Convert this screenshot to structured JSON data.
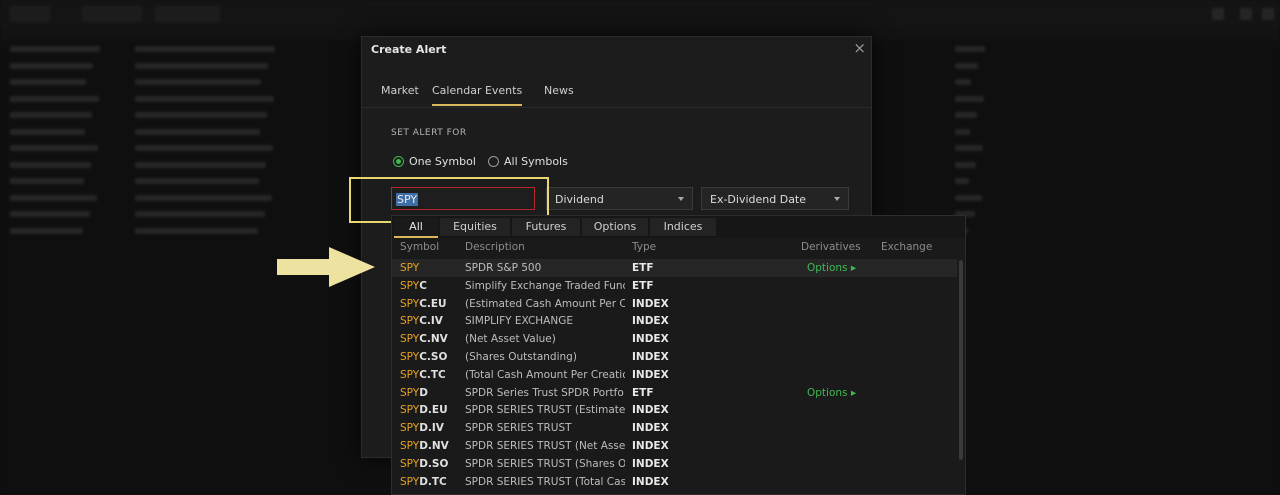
{
  "modal": {
    "title": "Create Alert",
    "close": "×",
    "tabs": [
      "Market",
      "Calendar Events",
      "News"
    ],
    "active_tab": "Calendar Events",
    "section_label": "SET ALERT FOR",
    "radio_one": "One Symbol",
    "radio_all": "All Symbols",
    "symbol_value": "SPY",
    "event_type": "Dividend",
    "date_field": "Ex-Dividend Date"
  },
  "results": {
    "tabs": [
      "All",
      "Equities",
      "Futures",
      "Options",
      "Indices"
    ],
    "columns": [
      "Symbol",
      "Description",
      "Type",
      "Derivatives",
      "Exchange"
    ],
    "rows": [
      {
        "match": "SPY",
        "rest": "",
        "desc": "SPDR S&P 500",
        "type": "ETF",
        "deriv": "Options ▸"
      },
      {
        "match": "SPY",
        "rest": "C",
        "desc": "Simplify Exchange Traded Fund",
        "type": "ETF",
        "deriv": ""
      },
      {
        "match": "SPY",
        "rest": "C.EU",
        "desc": "(Estimated Cash Amount Per C",
        "type": "INDEX",
        "deriv": ""
      },
      {
        "match": "SPY",
        "rest": "C.IV",
        "desc": "SIMPLIFY EXCHANGE",
        "type": "INDEX",
        "deriv": ""
      },
      {
        "match": "SPY",
        "rest": "C.NV",
        "desc": "(Net Asset Value)",
        "type": "INDEX",
        "deriv": ""
      },
      {
        "match": "SPY",
        "rest": "C.SO",
        "desc": "(Shares Outstanding)",
        "type": "INDEX",
        "deriv": ""
      },
      {
        "match": "SPY",
        "rest": "C.TC",
        "desc": "(Total Cash Amount Per Creation",
        "type": "INDEX",
        "deriv": ""
      },
      {
        "match": "SPY",
        "rest": "D",
        "desc": "SPDR Series Trust SPDR Portfo",
        "type": "ETF",
        "deriv": "Options ▸"
      },
      {
        "match": "SPY",
        "rest": "D.EU",
        "desc": "SPDR SERIES TRUST (Estimated",
        "type": "INDEX",
        "deriv": ""
      },
      {
        "match": "SPY",
        "rest": "D.IV",
        "desc": "SPDR SERIES TRUST",
        "type": "INDEX",
        "deriv": ""
      },
      {
        "match": "SPY",
        "rest": "D.NV",
        "desc": "SPDR SERIES TRUST (Net Asset",
        "type": "INDEX",
        "deriv": ""
      },
      {
        "match": "SPY",
        "rest": "D.SO",
        "desc": "SPDR SERIES TRUST (Shares Ou",
        "type": "INDEX",
        "deriv": ""
      },
      {
        "match": "SPY",
        "rest": "D.TC",
        "desc": "SPDR SERIES TRUST (Total Cash",
        "type": "INDEX",
        "deriv": ""
      }
    ]
  },
  "colors": {
    "accent": "#d7b85a",
    "highlight": "#e7d873",
    "match": "#e8a21f",
    "green": "#3fb950",
    "error": "#b3262f"
  }
}
